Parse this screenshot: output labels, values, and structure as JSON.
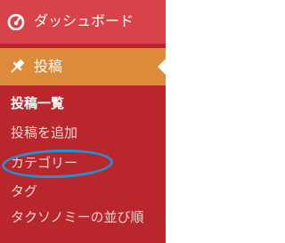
{
  "menu": {
    "dashboard": {
      "label": "ダッシュボード",
      "icon": "dashboard-gauge-icon"
    },
    "posts": {
      "label": "投稿",
      "icon": "pushpin-icon",
      "submenu": [
        {
          "label": "投稿一覧",
          "current": true
        },
        {
          "label": "投稿を追加",
          "current": false
        },
        {
          "label": "カテゴリー",
          "current": false,
          "highlighted": true
        },
        {
          "label": "タグ",
          "current": false
        },
        {
          "label": "タクソノミーの並び順",
          "current": false
        }
      ]
    }
  },
  "colors": {
    "sidebar_bg": "#b9262c",
    "top_item_bg": "#d8434a",
    "current_item_bg": "#dd8a3a",
    "highlight_ring": "#1f93d6",
    "text": "#ffffff",
    "submenu_text": "#f1d4d4"
  }
}
